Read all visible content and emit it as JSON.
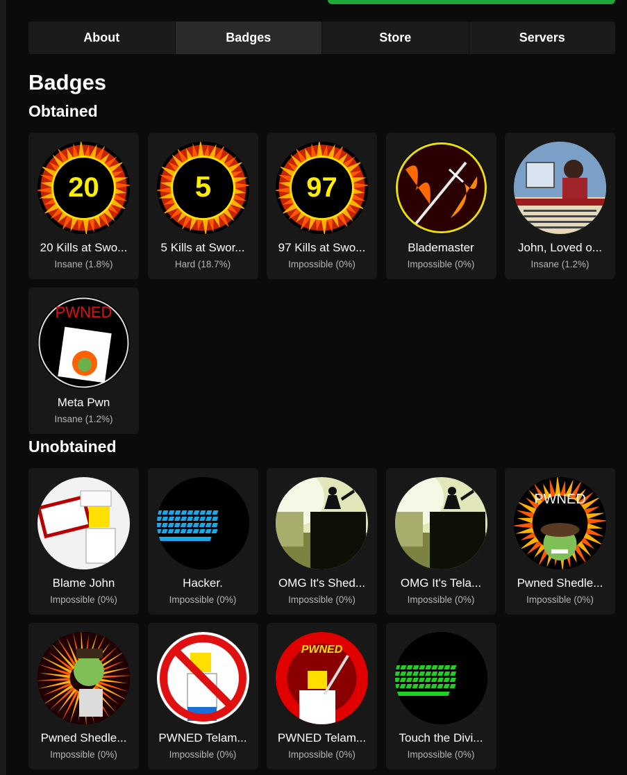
{
  "tabs": [
    {
      "label": "About",
      "active": false
    },
    {
      "label": "Badges",
      "active": true
    },
    {
      "label": "Store",
      "active": false
    },
    {
      "label": "Servers",
      "active": false
    }
  ],
  "page_title": "Badges",
  "obtained": {
    "title": "Obtained",
    "badges": [
      {
        "name": "20 Kills at Swo...",
        "rarity": "Insane (1.8%)",
        "image": "fire-ring-number",
        "number": "20"
      },
      {
        "name": "5 Kills at Swor...",
        "rarity": "Hard (18.7%)",
        "image": "fire-ring-number",
        "number": "5"
      },
      {
        "name": "97 Kills at Swo...",
        "rarity": "Impossible (0%)",
        "image": "fire-ring-number",
        "number": "97"
      },
      {
        "name": "Blademaster",
        "rarity": "Impossible (0%)",
        "image": "sword-fire"
      },
      {
        "name": "John, Loved o...",
        "rarity": "Insane (1.2%)",
        "image": "card-photo"
      },
      {
        "name": "Meta Pwn",
        "rarity": "Insane (1.2%)",
        "image": "pwned-card",
        "number": "PWNED"
      }
    ]
  },
  "unobtained": {
    "title": "Unobtained",
    "badges": [
      {
        "name": "Blame John",
        "rarity": "Impossible (0%)",
        "image": "blame-john"
      },
      {
        "name": "Hacker.",
        "rarity": "Impossible (0%)",
        "image": "hacker-blue"
      },
      {
        "name": "OMG It's Shed...",
        "rarity": "Impossible (0%)",
        "image": "omg-silhouette"
      },
      {
        "name": "OMG It's Tela...",
        "rarity": "Impossible (0%)",
        "image": "omg-silhouette"
      },
      {
        "name": "Pwned Shedle...",
        "rarity": "Impossible (0%)",
        "image": "pwned-face",
        "number": "PWNED"
      },
      {
        "name": "Pwned Shedle...",
        "rarity": "Impossible (0%)",
        "image": "fire-zombie"
      },
      {
        "name": "PWNED Telam...",
        "rarity": "Impossible (0%)",
        "image": "no-sign"
      },
      {
        "name": "PWNED Telam...",
        "rarity": "Impossible (0%)",
        "image": "pwned-red",
        "number": "PWNED"
      },
      {
        "name": "Touch the Divi...",
        "rarity": "Impossible (0%)",
        "image": "hacker-green"
      }
    ]
  },
  "colors": {
    "background": "#0b0b0b",
    "card": "#181818",
    "tab_bar": "#1b1b1b",
    "tab_active": "#2a2a2a",
    "rarity_text": "#b5b5b5",
    "green_button": "#1aa83a"
  }
}
